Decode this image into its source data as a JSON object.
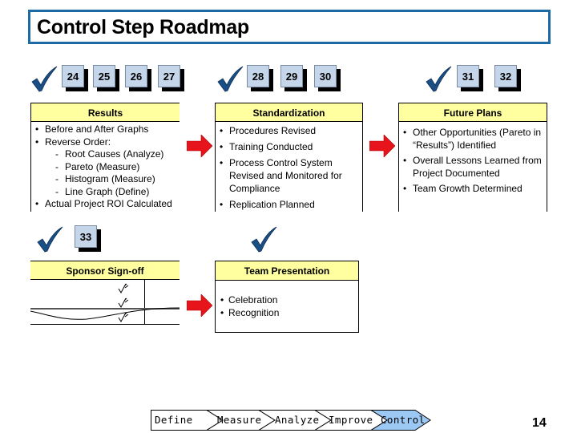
{
  "title": "Control Step Roadmap",
  "colors": {
    "title_border": "#1c6aa6",
    "header_fill": "#ffffa0",
    "badge_fill": "#c5d5ea",
    "check_blue": "#1a4f86",
    "arrow_red": "#e8141c",
    "active_phase": "#9cc8f4"
  },
  "groups": [
    {
      "check_icon": "checkmark-icon",
      "steps": [
        "24",
        "25",
        "26",
        "27"
      ],
      "panel": {
        "header": "Results",
        "items": [
          {
            "text": "Before and After Graphs",
            "level": 0
          },
          {
            "text": "Reverse Order:",
            "level": 0
          },
          {
            "text": "Root Causes (Analyze)",
            "level": 1
          },
          {
            "text": "Pareto (Measure)",
            "level": 1
          },
          {
            "text": "Histogram (Measure)",
            "level": 1
          },
          {
            "text": "Line Graph (Define)",
            "level": 1
          },
          {
            "text": "Actual Project ROI Calculated",
            "level": 0
          }
        ]
      }
    },
    {
      "check_icon": "checkmark-icon",
      "steps": [
        "28",
        "29",
        "30"
      ],
      "panel": {
        "header": "Standardization",
        "items": [
          {
            "text": "Procedures Revised",
            "level": 0
          },
          {
            "text": "Training Conducted",
            "level": 0
          },
          {
            "text": "Process Control System Revised and Monitored for Compliance",
            "level": 0
          },
          {
            "text": "Replication Planned",
            "level": 0
          }
        ]
      }
    },
    {
      "check_icon": "checkmark-icon",
      "steps": [
        "31",
        "32"
      ],
      "panel": {
        "header": "Future Plans",
        "items": [
          {
            "text": "Other Opportunities (Pareto in “Results”) Identified",
            "level": 0
          },
          {
            "text": "Overall Lessons Learned from Project Documented",
            "level": 0
          },
          {
            "text": "Team Growth Determined",
            "level": 0
          }
        ]
      }
    },
    {
      "check_icon": "checkmark-icon",
      "steps": [
        "33"
      ],
      "panel": {
        "header": "Sponsor Sign-off",
        "signature_marks": 3
      }
    },
    {
      "check_icon": "checkmark-icon",
      "steps": [],
      "panel": {
        "header": "Team Presentation",
        "items": [
          {
            "text": "Celebration",
            "level": 0
          },
          {
            "text": "Recognition",
            "level": 0
          }
        ]
      }
    }
  ],
  "dmaic": {
    "phases": [
      "Define",
      "Measure",
      "Analyze",
      "Improve",
      "Control"
    ],
    "active": "Control"
  },
  "page_number": "14"
}
